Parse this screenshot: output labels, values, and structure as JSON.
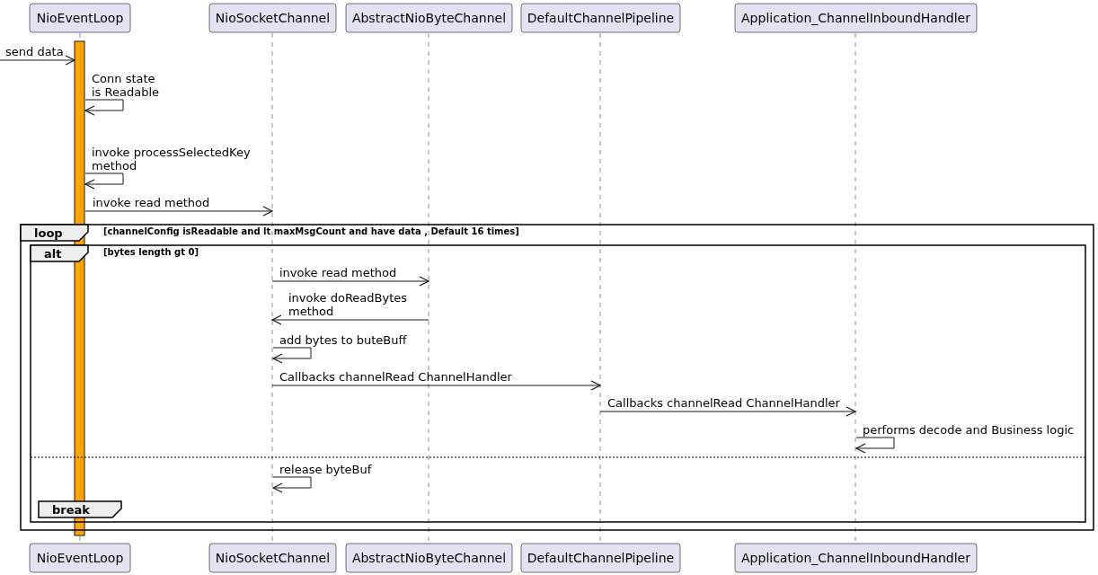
{
  "participants_top": [
    {
      "label": "NioEventLoop"
    },
    {
      "label": "NioSocketChannel"
    },
    {
      "label": "AbstractNioByteChannel"
    },
    {
      "label": "DefaultChannelPipeline"
    },
    {
      "label": "Application_ChannelInboundHandler"
    }
  ],
  "messages": [
    {
      "kind": "found",
      "lines": [
        "send data"
      ]
    },
    {
      "kind": "self",
      "lines": [
        "Conn state",
        "is Readable"
      ]
    },
    {
      "kind": "self",
      "lines": [
        "invoke processSelectedKey",
        "method"
      ]
    },
    {
      "kind": "call",
      "lines": [
        "invoke read method"
      ]
    },
    {
      "kind": "call",
      "lines": [
        "invoke read method"
      ]
    },
    {
      "kind": "call",
      "lines": [
        "invoke doReadBytes",
        "method"
      ]
    },
    {
      "kind": "self",
      "lines": [
        "add bytes to buteBuff"
      ]
    },
    {
      "kind": "call",
      "lines": [
        "Callbacks channelRead ChannelHandler"
      ]
    },
    {
      "kind": "call",
      "lines": [
        "Callbacks channelRead ChannelHandler"
      ]
    },
    {
      "kind": "self",
      "lines": [
        "performs decode and Business logic"
      ]
    },
    {
      "kind": "self",
      "lines": [
        "release byteBuf"
      ]
    }
  ],
  "frames": [
    {
      "kind": "loop",
      "label": "loop",
      "guard": "[channelConfig isReadable and lt maxMsgCount and have data , Default 16 times]"
    },
    {
      "kind": "alt",
      "label": "alt",
      "guard": "[bytes length gt 0]"
    },
    {
      "kind": "break",
      "label": "break"
    }
  ],
  "participants_bottom": [
    {
      "label": "NioEventLoop"
    },
    {
      "label": "NioSocketChannel"
    },
    {
      "label": "AbstractNioByteChannel"
    },
    {
      "label": "DefaultChannelPipeline"
    },
    {
      "label": "Application_ChannelInboundHandler"
    }
  ]
}
